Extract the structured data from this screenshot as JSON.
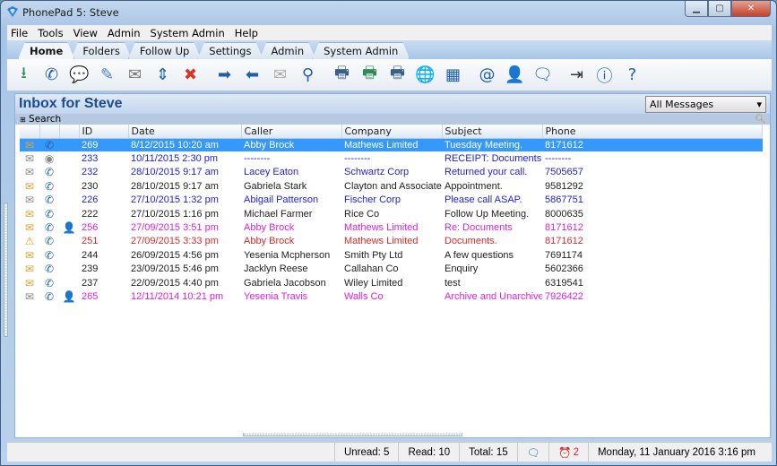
{
  "window": {
    "title": "PhonePad 5: Steve",
    "controls": [
      "minimize",
      "maximize",
      "close"
    ]
  },
  "menu": [
    "File",
    "Tools",
    "View",
    "Admin",
    "System Admin",
    "Help"
  ],
  "tabs": [
    {
      "label": "Home",
      "active": true
    },
    {
      "label": "Folders"
    },
    {
      "label": "Follow Up"
    },
    {
      "label": "Settings"
    },
    {
      "label": "Admin"
    },
    {
      "label": "System Admin"
    }
  ],
  "toolbar": [
    {
      "name": "download-icon",
      "glyph": "⭳",
      "color": "#2e8b57"
    },
    {
      "name": "phone-icon",
      "glyph": "✆",
      "color": "#1f5fa8"
    },
    {
      "name": "phone-message-icon",
      "glyph": "💬",
      "color": "#1f5fa8"
    },
    {
      "name": "edit-document-icon",
      "glyph": "✎",
      "color": "#4a7fc1"
    },
    {
      "name": "mail-read-icon",
      "glyph": "✉",
      "color": "#777"
    },
    {
      "name": "phone-transfer-icon",
      "glyph": "⇕",
      "color": "#1f5fa8"
    },
    {
      "name": "delete-message-icon",
      "glyph": "✖",
      "color": "#d9342b"
    },
    {
      "name": "forward-message-icon",
      "glyph": "➡",
      "color": "#1f5fa8",
      "gap": true
    },
    {
      "name": "reply-message-icon",
      "glyph": "⬅",
      "color": "#1f5fa8"
    },
    {
      "name": "mail-archive-icon",
      "glyph": "✉",
      "color": "#aaa"
    },
    {
      "name": "search-icon",
      "glyph": "⚲",
      "color": "#1f5fa8"
    },
    {
      "name": "print-icon",
      "glyph": "🖶",
      "color": "#3a5f8a",
      "gap": true
    },
    {
      "name": "print-approve-icon",
      "glyph": "🖶",
      "color": "#2e8b57"
    },
    {
      "name": "print-preview-icon",
      "glyph": "🖶",
      "color": "#3a5f8a"
    },
    {
      "name": "email-web-icon",
      "glyph": "🌐",
      "color": "#1f5fa8"
    },
    {
      "name": "calculator-icon",
      "glyph": "▦",
      "color": "#1f5fa8"
    },
    {
      "name": "address-book-icon",
      "glyph": "@",
      "color": "#1f5fa8",
      "gap": true
    },
    {
      "name": "user-help-icon",
      "glyph": "👤",
      "color": "#1f5fa8"
    },
    {
      "name": "chat-user-icon",
      "glyph": "🗨",
      "color": "#1f5fa8"
    },
    {
      "name": "sign-in-icon",
      "glyph": "⇥",
      "color": "#333",
      "gap": true
    },
    {
      "name": "info-icon",
      "glyph": "ⓘ",
      "color": "#1f5fa8"
    },
    {
      "name": "help-icon",
      "glyph": "?",
      "color": "#1f5fa8"
    }
  ],
  "inbox": {
    "title": "Inbox for Steve",
    "filter": "All Messages",
    "search_label": "Search"
  },
  "columns": [
    "",
    "",
    "",
    "ID",
    "Date",
    "Caller",
    "Company",
    "Subject",
    "Phone"
  ],
  "colors": {
    "black": "#222222",
    "blue": "#2121e6",
    "pink": "#e020e0",
    "red": "#e02828",
    "selected": "#3399ff"
  },
  "rows": [
    {
      "status": "unread",
      "type": "phone",
      "flag": "",
      "id": "269",
      "date": "8/12/2015 10:20 am",
      "caller": "Abby Brock",
      "company": "Mathews Limited",
      "subject": "Tuesday Meeting.",
      "phone": "8171612",
      "color": "black",
      "selected": true
    },
    {
      "status": "read",
      "type": "receipt",
      "flag": "",
      "id": "233",
      "date": "10/11/2015 2:30 pm",
      "caller": "--------",
      "company": "--------",
      "subject": "RECEIPT: Documents f...",
      "phone": "--------",
      "color": "blue"
    },
    {
      "status": "read",
      "type": "phone",
      "flag": "",
      "id": "232",
      "date": "28/10/2015 9:17 am",
      "caller": "Lacey Eaton",
      "company": "Schwartz Corp",
      "subject": "Returned your call.",
      "phone": "7505657",
      "color": "blue"
    },
    {
      "status": "unread",
      "type": "phone",
      "flag": "",
      "id": "230",
      "date": "28/10/2015 9:17 am",
      "caller": "Gabriela Stark",
      "company": "Clayton and Associates",
      "subject": "Appointment.",
      "phone": "9581292",
      "color": "black"
    },
    {
      "status": "read",
      "type": "phone",
      "flag": "",
      "id": "226",
      "date": "27/10/2015 1:32 pm",
      "caller": "Abigail Patterson",
      "company": "Fischer Corp",
      "subject": "Please call ASAP.",
      "phone": "5867751",
      "color": "blue"
    },
    {
      "status": "unread",
      "type": "phone",
      "flag": "",
      "id": "222",
      "date": "27/10/2015 1:16 pm",
      "caller": "Michael Farmer",
      "company": "Rice Co",
      "subject": "Follow Up Meeting.",
      "phone": "8000635",
      "color": "black"
    },
    {
      "status": "unread",
      "type": "phone",
      "flag": "assigned",
      "id": "256",
      "date": "27/09/2015 3:51 pm",
      "caller": "Abby Brock",
      "company": "Mathews Limited",
      "subject": "Re: Documents",
      "phone": "8171612",
      "color": "pink"
    },
    {
      "status": "urgent",
      "type": "phone",
      "flag": "",
      "id": "251",
      "date": "27/09/2015 3:33 pm",
      "caller": "Abby Brock",
      "company": "Mathews Limited",
      "subject": "Documents.",
      "phone": "8171612",
      "color": "red"
    },
    {
      "status": "unread",
      "type": "phone",
      "flag": "",
      "id": "244",
      "date": "26/09/2015 4:56 pm",
      "caller": "Yesenia Mcpherson",
      "company": "Smith Pty Ltd",
      "subject": "A few questions",
      "phone": "7691174",
      "color": "black"
    },
    {
      "status": "unread",
      "type": "phone",
      "flag": "",
      "id": "239",
      "date": "23/09/2015 5:46 pm",
      "caller": "Jacklyn Reese",
      "company": "Callahan Co",
      "subject": "Enquiry",
      "phone": "5602366",
      "color": "black"
    },
    {
      "status": "unread",
      "type": "phone",
      "flag": "",
      "id": "237",
      "date": "22/09/2015 4:40 pm",
      "caller": "Gabriela Jacobson",
      "company": "Wiley Limited",
      "subject": "test",
      "phone": "6319541",
      "color": "black"
    },
    {
      "status": "read",
      "type": "phone",
      "flag": "assigned",
      "id": "265",
      "date": "12/11/2014 10:21 pm",
      "caller": "Yesenia Travis",
      "company": "Walls Co",
      "subject": "Archive and Unarchive...",
      "phone": "7926422",
      "color": "pink"
    }
  ],
  "status": {
    "unread": "Unread: 5",
    "read": "Read: 10",
    "total": "Total: 15",
    "alarm_count": "2",
    "datetime": "Monday, 11 January 2016  3:16 pm"
  }
}
